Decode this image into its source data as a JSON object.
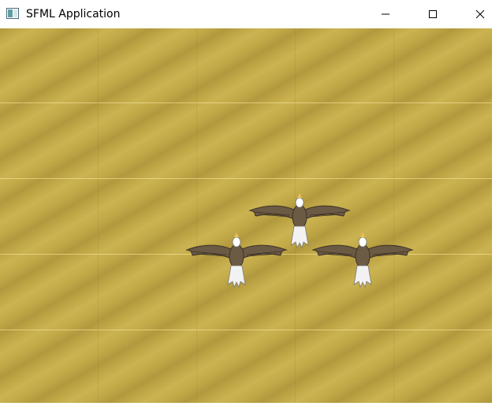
{
  "window": {
    "title": "SFML Application",
    "controls": {
      "minimize_icon": "minimize-icon",
      "maximize_icon": "maximize-icon",
      "close_icon": "close-icon"
    }
  },
  "scene": {
    "background": "sand-texture",
    "sprites": [
      {
        "type": "eagle",
        "name": "eagle-leader"
      },
      {
        "type": "eagle",
        "name": "eagle-left-wingman"
      },
      {
        "type": "eagle",
        "name": "eagle-right-wingman"
      }
    ]
  },
  "colors": {
    "sand": "#c2a947",
    "eagle_body": "#6b5a44",
    "eagle_tail": "#f2f2f2",
    "eagle_beak": "#e8c15a"
  }
}
